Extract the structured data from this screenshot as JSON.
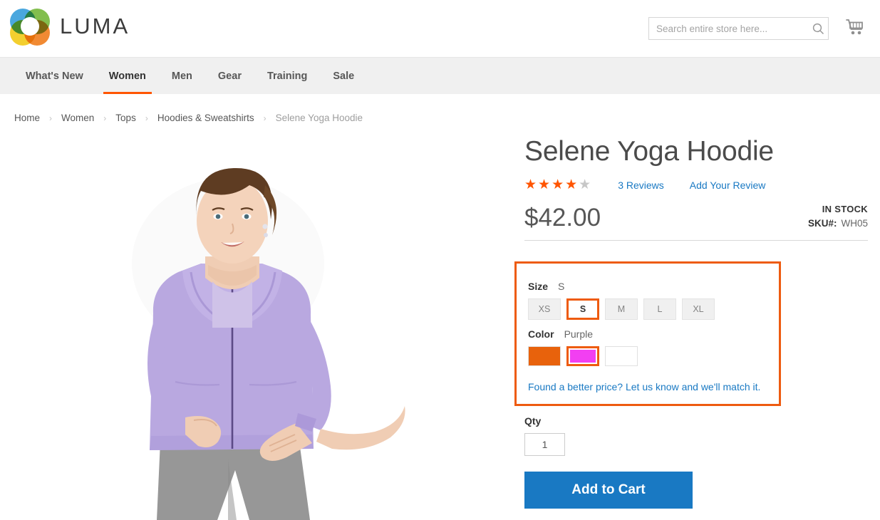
{
  "header": {
    "brand": "LUMA",
    "logo_icon": "luma-flower-logo",
    "search": {
      "placeholder": "Search entire store here...",
      "value": "",
      "icon": "search-icon"
    },
    "cart_icon": "shopping-cart-icon"
  },
  "nav": {
    "items": [
      {
        "label": "What's New",
        "active": false
      },
      {
        "label": "Women",
        "active": true
      },
      {
        "label": "Men",
        "active": false
      },
      {
        "label": "Gear",
        "active": false
      },
      {
        "label": "Training",
        "active": false
      },
      {
        "label": "Sale",
        "active": false
      }
    ],
    "active_accent": "#ff5501"
  },
  "breadcrumb": {
    "separator": "›",
    "items": [
      {
        "label": "Home",
        "current": false
      },
      {
        "label": "Women",
        "current": false
      },
      {
        "label": "Tops",
        "current": false
      },
      {
        "label": "Hoodies & Sweatshirts",
        "current": false
      },
      {
        "label": "Selene Yoga Hoodie",
        "current": true
      }
    ]
  },
  "product": {
    "title": "Selene Yoga Hoodie",
    "rating": {
      "filled": 4,
      "total": 5,
      "stars_filled": "★★★★",
      "stars_empty": "★"
    },
    "reviews_link": "3 Reviews",
    "add_review_link": "Add Your Review",
    "price": "$42.00",
    "stock_status": "IN STOCK",
    "sku_label": "SKU#:",
    "sku_value": "WH05",
    "image_alt": "Model wearing lavender Selene Yoga Hoodie with grey pants"
  },
  "options": {
    "highlight_color": "#ee5b10",
    "size": {
      "label": "Size",
      "selected": "S",
      "values": [
        {
          "label": "XS",
          "selected": false
        },
        {
          "label": "S",
          "selected": true
        },
        {
          "label": "M",
          "selected": false
        },
        {
          "label": "L",
          "selected": false
        },
        {
          "label": "XL",
          "selected": false
        }
      ]
    },
    "color": {
      "label": "Color",
      "selected": "Purple",
      "values": [
        {
          "name": "Orange",
          "hex": "#e8620c",
          "selected": false
        },
        {
          "name": "Purple",
          "hex": "#f23ff2",
          "selected": true
        },
        {
          "name": "White",
          "hex": "#ffffff",
          "selected": false
        }
      ]
    },
    "price_match_text": "Found a better price? Let us know and we'll match it."
  },
  "purchase": {
    "qty_label": "Qty",
    "qty_value": "1",
    "add_to_cart_label": "Add to Cart",
    "button_color": "#1979c3"
  }
}
